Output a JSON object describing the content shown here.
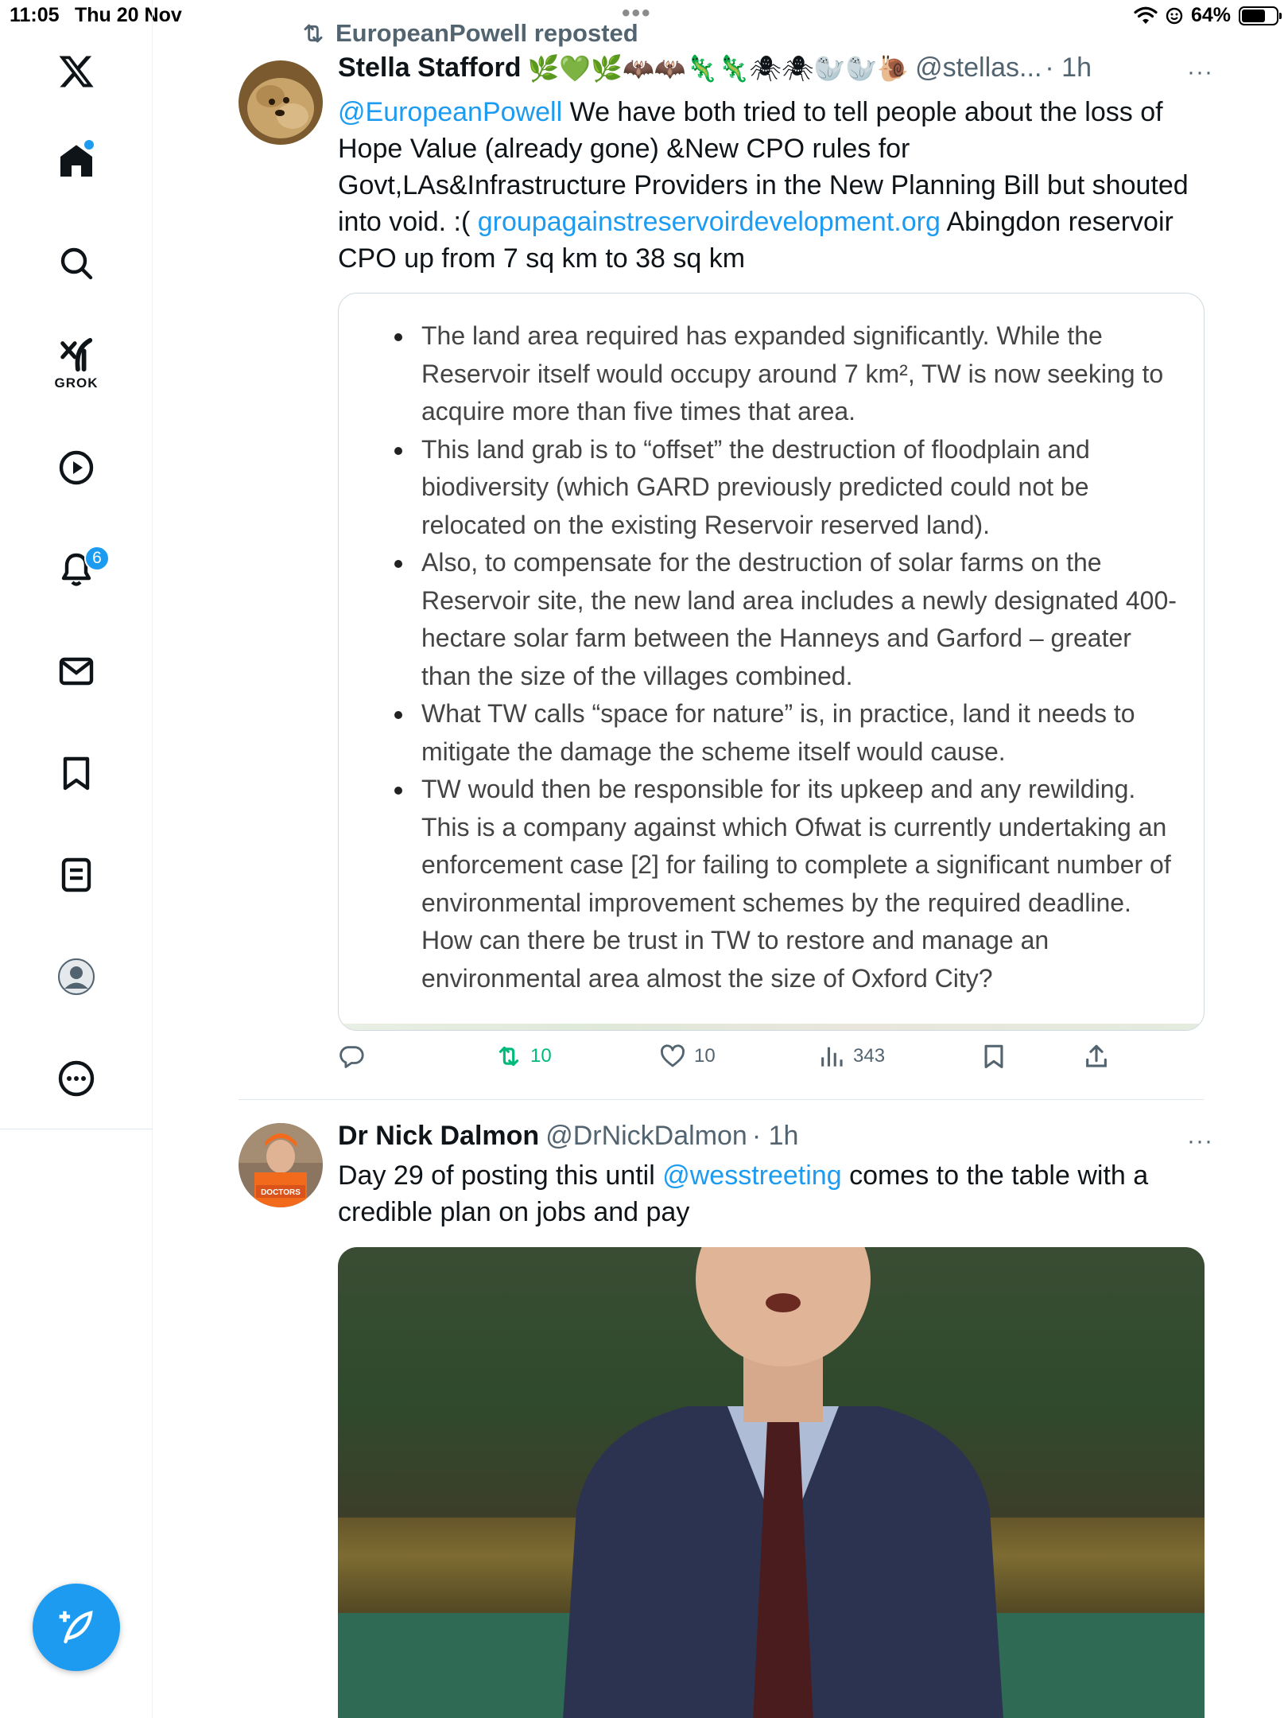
{
  "status_bar": {
    "time": "11:05",
    "date": "Thu 20 Nov",
    "battery": "64%"
  },
  "sidebar": {
    "items": [
      {
        "name": "x-logo",
        "label": ""
      },
      {
        "name": "home",
        "label": ""
      },
      {
        "name": "search",
        "label": ""
      },
      {
        "name": "grok",
        "label": "GROK"
      },
      {
        "name": "video",
        "label": ""
      },
      {
        "name": "notifications",
        "label": "",
        "badge": "6"
      },
      {
        "name": "messages",
        "label": ""
      },
      {
        "name": "bookmarks",
        "label": ""
      },
      {
        "name": "lists",
        "label": ""
      },
      {
        "name": "profile",
        "label": ""
      },
      {
        "name": "more",
        "label": ""
      }
    ]
  },
  "colors": {
    "accent": "#1d9bf0",
    "text": "#0f1419",
    "secondary": "#536471",
    "repost_green": "#00ba7c"
  },
  "tweet1": {
    "repost_label": "EuropeanPowell reposted",
    "author_name": "Stella Stafford",
    "emojis": "🌿💚🌿🦇🦇🦎🦎🕷🕷🦭🦭🐌",
    "handle": "@stellas...",
    "time": "· 1h",
    "more": "···",
    "mention": "@EuropeanPowell",
    "text_part1": " We have both tried to tell people about the loss of Hope Value (already gone) &New CPO rules for Govt,LAs&Infrastructure Providers in the New Planning Bill but shouted into void. :( ",
    "link": "groupagainstreservoirdevelopment.org",
    "text_part2": " Abingdon reservoir CPO up from 7 sq km to 38 sq km",
    "card_bullets": [
      "The land area required has expanded significantly. While the Reservoir itself would occupy around 7 km², TW is now seeking to acquire more than five times that area.",
      "This land grab is to “offset” the destruction of floodplain and biodiversity (which GARD previously predicted could not be relocated on the existing Reservoir reserved land).",
      "Also, to compensate for the destruction of solar farms on the Reservoir site, the new land area includes a newly designated 400-hectare solar farm between the Hanneys and Garford – greater than the size of the villages combined.",
      "What TW calls “space for nature” is, in practice, land it needs to mitigate the damage the scheme itself would cause.",
      "TW would then be responsible for its upkeep and any rewilding. This is a company against which Ofwat is currently undertaking an enforcement case [2] for failing to complete a significant number of environmental improvement schemes by the required deadline. How can there be trust in TW to restore and manage an environmental area almost the size of Oxford City?"
    ],
    "actions": {
      "reply_count": "",
      "repost_count": "10",
      "like_count": "10",
      "views_count": "343"
    }
  },
  "tweet2": {
    "author_name": "Dr Nick Dalmon",
    "handle": "@DrNickDalmon",
    "time": "· 1h",
    "more": "···",
    "text_part1": "Day 29 of posting this until ",
    "mention": "@wesstreeting",
    "text_part2": " comes to the table with a credible plan on jobs and pay",
    "avatar_sign": "DOCTORS"
  }
}
